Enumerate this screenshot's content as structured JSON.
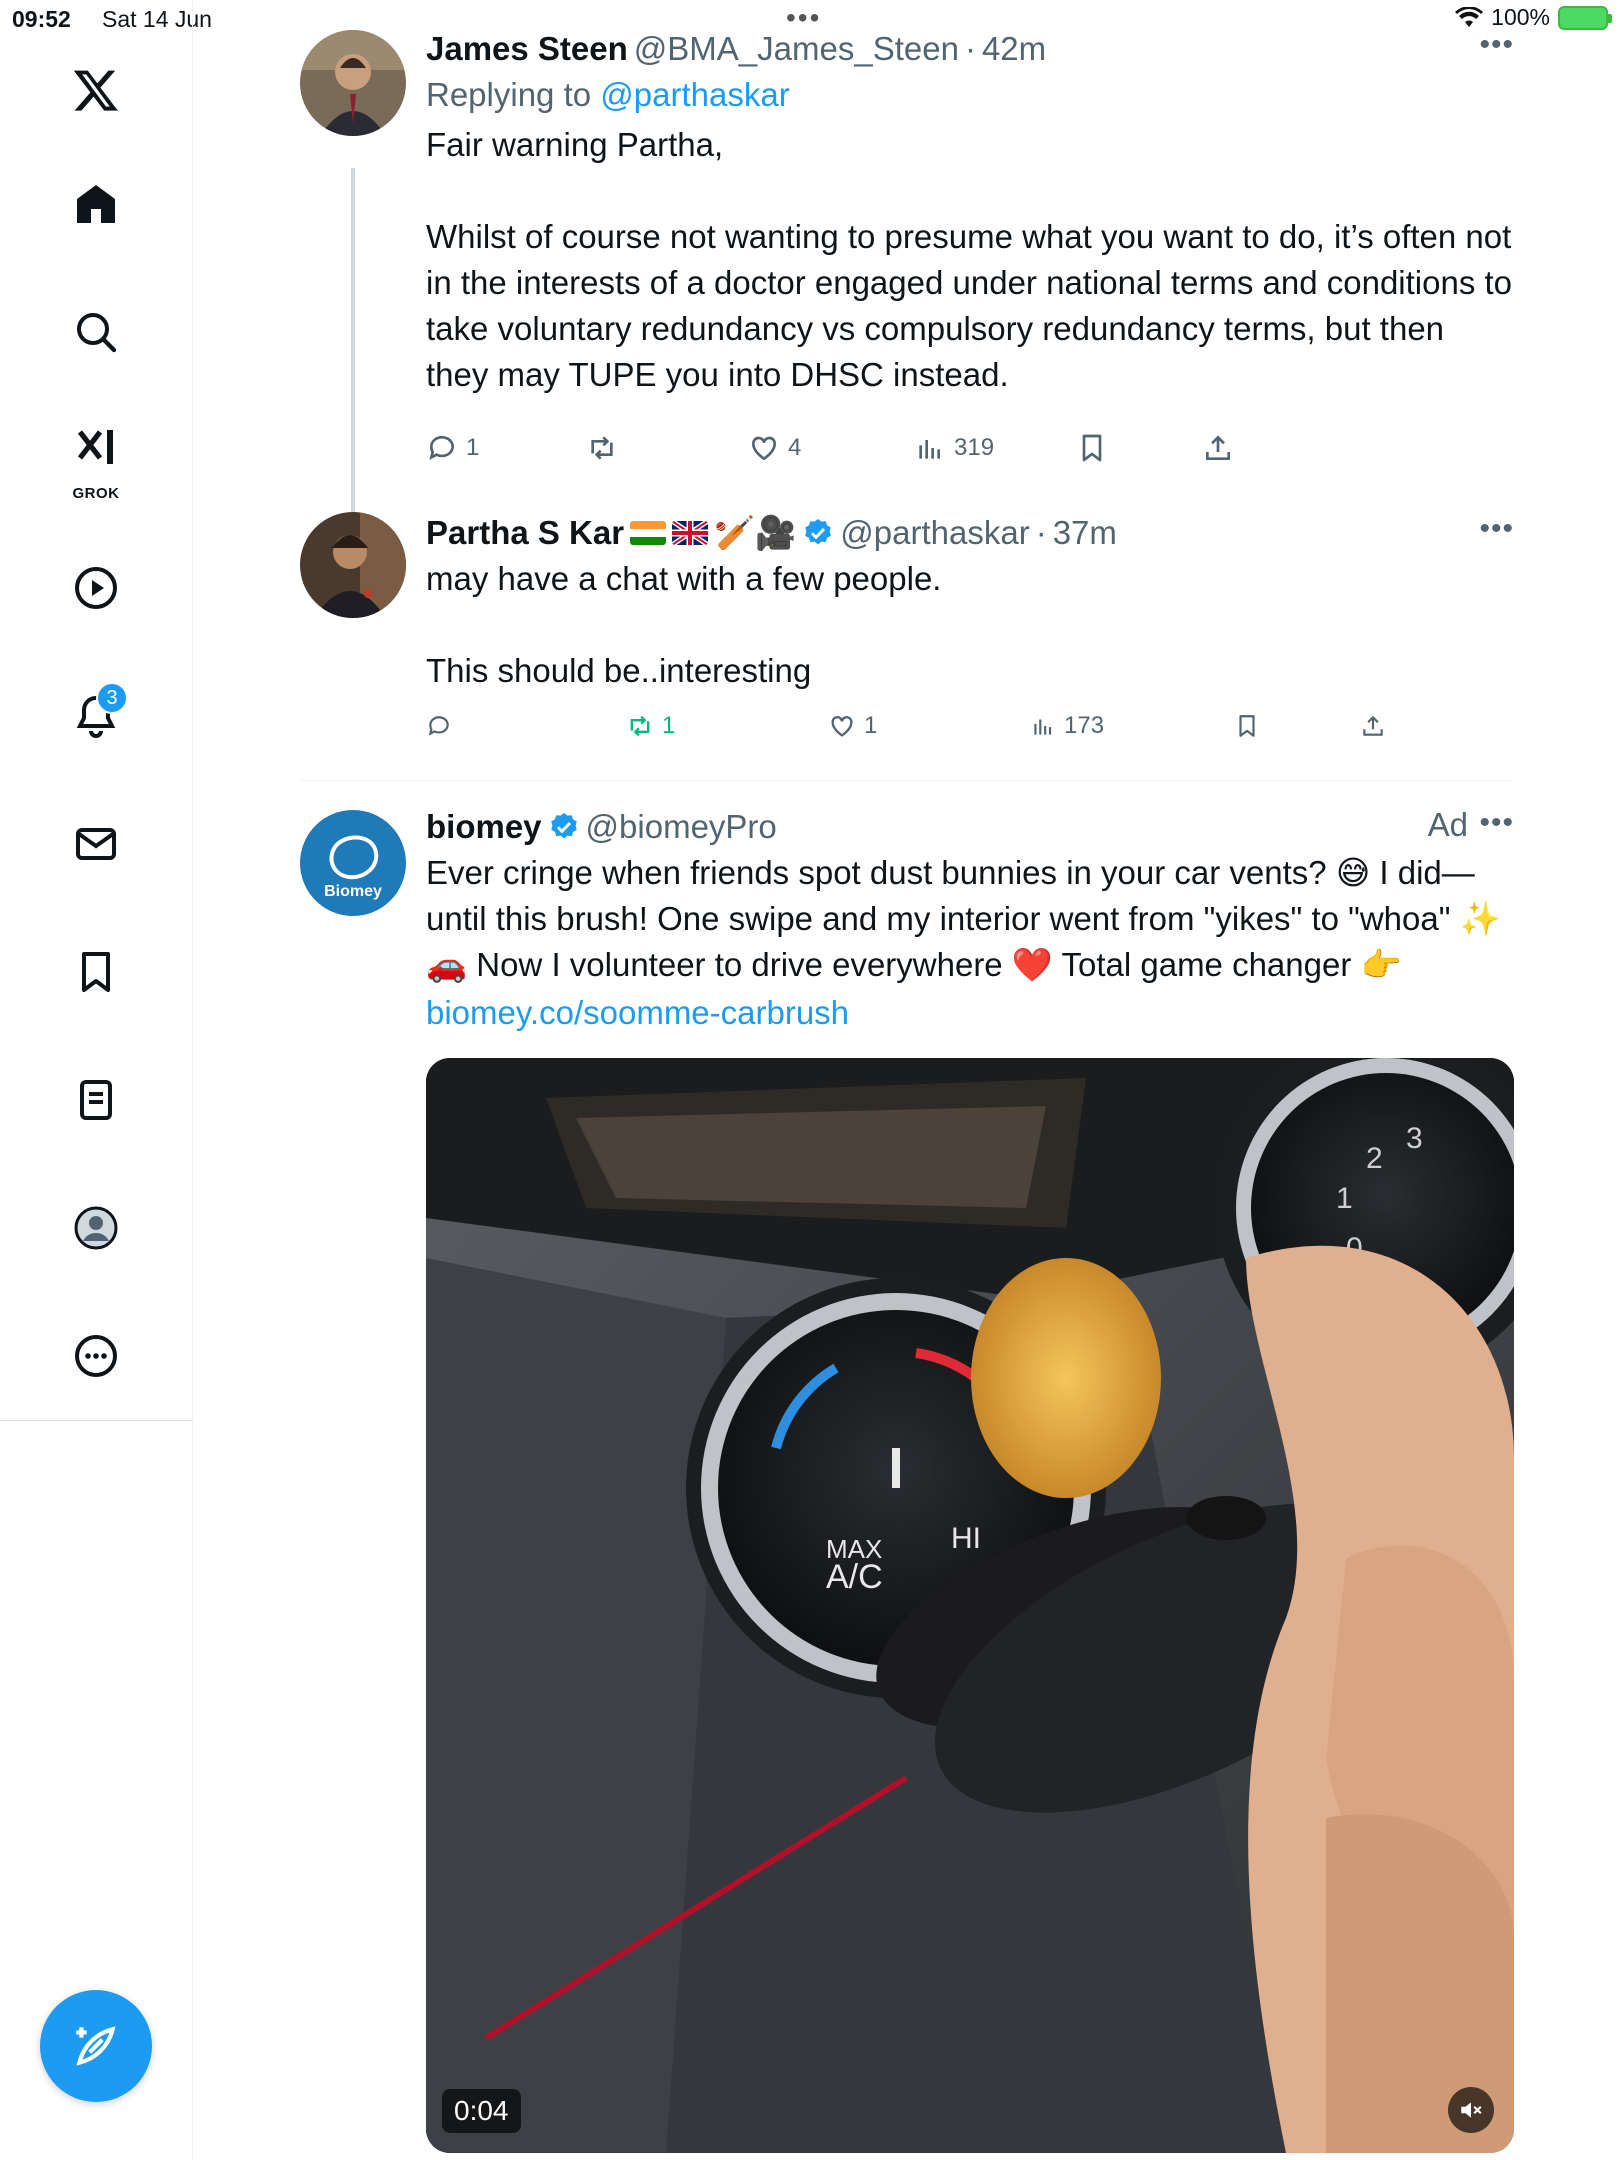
{
  "status_bar": {
    "time": "09:52",
    "date": "Sat 14 Jun",
    "battery": "100%"
  },
  "sidebar": {
    "items": [
      {
        "name": "home",
        "icon": "home-icon"
      },
      {
        "name": "explore",
        "icon": "search-icon"
      },
      {
        "name": "grok",
        "icon": "grok-icon",
        "label": "GROK"
      },
      {
        "name": "videos",
        "icon": "play-icon"
      },
      {
        "name": "notifications",
        "icon": "bell-icon",
        "badge": "3"
      },
      {
        "name": "messages",
        "icon": "mail-icon"
      },
      {
        "name": "bookmarks",
        "icon": "bookmark-icon"
      },
      {
        "name": "articles",
        "icon": "article-icon"
      },
      {
        "name": "profile",
        "icon": "profile-icon"
      },
      {
        "name": "more",
        "icon": "more-circle-icon"
      }
    ],
    "compose_icon": "compose-icon"
  },
  "tweets": [
    {
      "name": "James Steen",
      "handle": "@BMA_James_Steen",
      "time": "42m",
      "replying_prefix": "Replying to",
      "replying_to": "@parthaskar",
      "text": "Fair warning Partha,\n\nWhilst of course not wanting to presume what you want to do, it’s often not in the interests of a doctor engaged under national terms and conditions to take voluntary redundancy vs compulsory redundancy terms, but then they may TUPE you into DHSC instead.",
      "replies": "1",
      "retweets": "",
      "likes": "4",
      "views": "319"
    },
    {
      "name": "Partha S Kar",
      "emojis": "🏏🎥",
      "handle": "@parthaskar",
      "time": "37m",
      "text": "may have a chat with a few people.\n\nThis should be..interesting",
      "replies": "",
      "retweets": "1",
      "likes": "1",
      "views": "173"
    },
    {
      "name": "biomey",
      "handle": "@biomeyPro",
      "ad_label": "Ad",
      "avatar_label": "Biomey",
      "text": "Ever cringe when friends spot dust bunnies in your car vents? 😅 I did—until this brush! One swipe and my interior went from \"yikes\" to \"whoa\" ✨🚗 Now I volunteer to drive everywhere ❤️ Total game changer 👉",
      "link": "biomey.co/soomme-carbrush",
      "video_duration": "0:04",
      "dial_labels": [
        "MAX",
        "A/C",
        "HI",
        "1",
        "2",
        "3",
        "0"
      ]
    }
  ],
  "colors": {
    "accent": "#1d9bf0",
    "retweet_active": "#00ba7c",
    "text_secondary": "#536471"
  }
}
